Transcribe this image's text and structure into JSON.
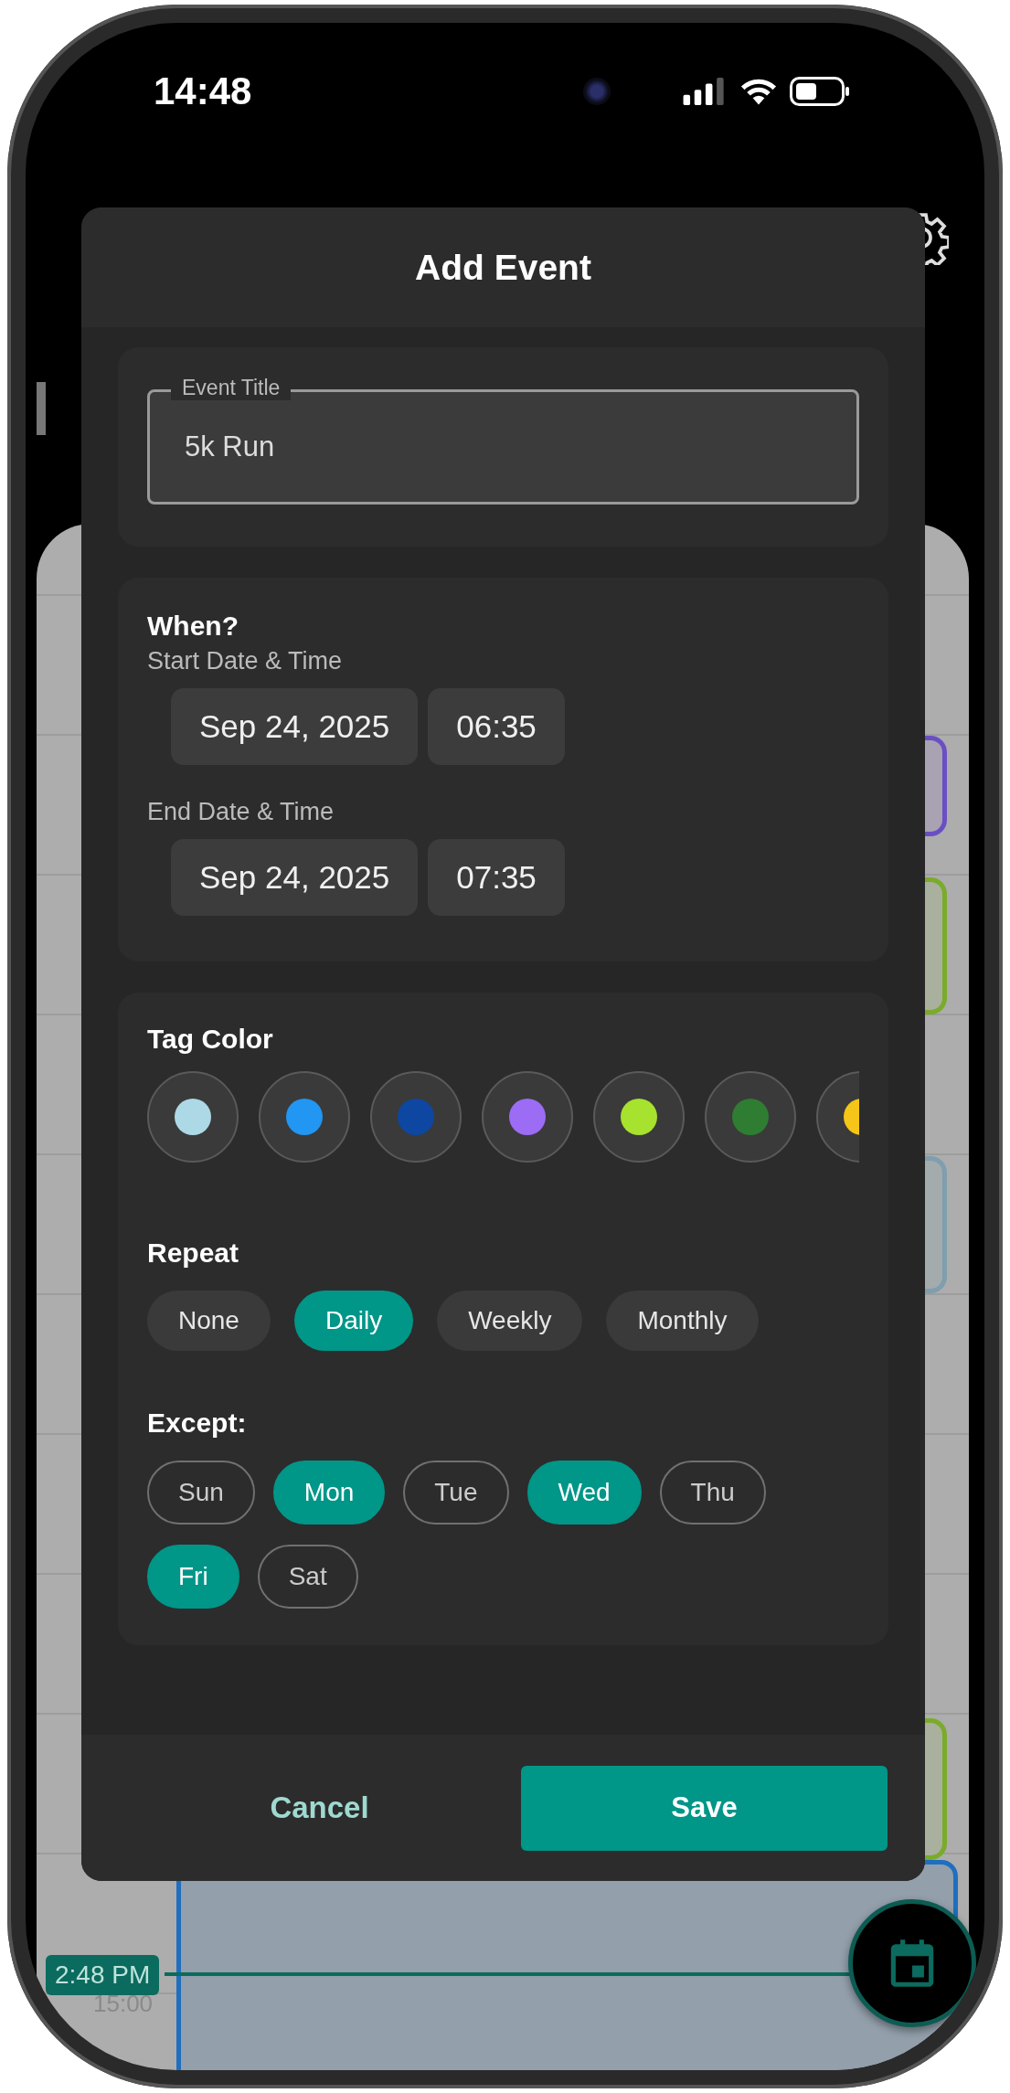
{
  "status_bar": {
    "time": "14:48"
  },
  "calendar": {
    "events": [
      {
        "color": "#6a4fc3"
      },
      {
        "color": "#7aab2a"
      },
      {
        "color": "#7f9eae"
      },
      {
        "color": "#7aab2a"
      },
      {
        "color": "#1e6fbf"
      }
    ],
    "now_badge": "2:48 PM",
    "hour_label": "15:00"
  },
  "dialog": {
    "title": "Add Event",
    "event_title": {
      "label": "Event Title",
      "value": "5k Run"
    },
    "when": {
      "heading": "When?",
      "start": {
        "label": "Start Date & Time",
        "date": "Sep 24, 2025",
        "time": "06:35"
      },
      "end": {
        "label": "End Date & Time",
        "date": "Sep 24, 2025",
        "time": "07:35"
      }
    },
    "tag_color": {
      "heading": "Tag Color",
      "colors": [
        {
          "color": "#add8e6"
        },
        {
          "color": "#2196f3"
        },
        {
          "color": "#0d47a1"
        },
        {
          "color": "#9c6cf5"
        },
        {
          "color": "#a7e22e"
        },
        {
          "color": "#2e7d32"
        },
        {
          "color": "#f5c518"
        }
      ]
    },
    "repeat": {
      "heading": "Repeat",
      "options": [
        {
          "label": "None",
          "selected": false
        },
        {
          "label": "Daily",
          "selected": true
        },
        {
          "label": "Weekly",
          "selected": false
        },
        {
          "label": "Monthly",
          "selected": false
        }
      ]
    },
    "except": {
      "heading": "Except:",
      "days": [
        {
          "label": "Sun",
          "selected": false
        },
        {
          "label": "Mon",
          "selected": true
        },
        {
          "label": "Tue",
          "selected": false
        },
        {
          "label": "Wed",
          "selected": true
        },
        {
          "label": "Thu",
          "selected": false
        },
        {
          "label": "Fri",
          "selected": true
        },
        {
          "label": "Sat",
          "selected": false
        }
      ]
    },
    "buttons": {
      "cancel": "Cancel",
      "save": "Save"
    }
  }
}
